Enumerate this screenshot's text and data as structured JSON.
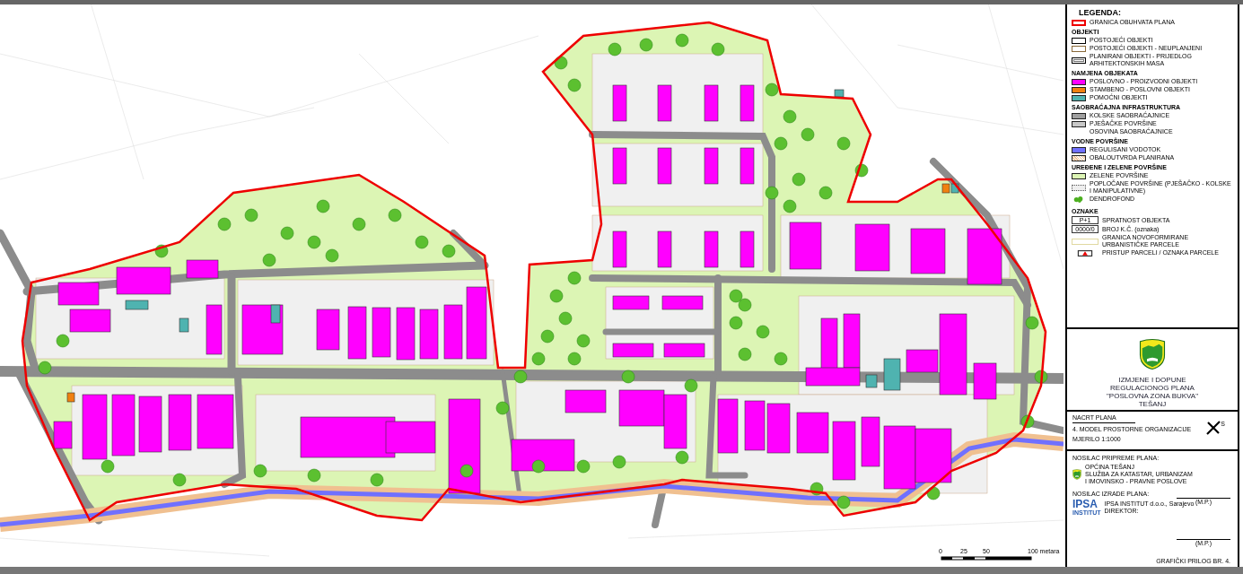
{
  "legend": {
    "title": "LEGENDA:",
    "boundary": {
      "label": "GRANICA OBUHVATA PLANA",
      "kind": "outline-red"
    },
    "sections": [
      {
        "heading": "OBJEKTI",
        "items": [
          {
            "label": "POSTOJEĆI OBJEKTI",
            "kind": "outline",
            "color": "#000000"
          },
          {
            "label": "POSTOJEĆI OBJEKTI - NEUPLANJENI",
            "kind": "outline",
            "color": "#8a6a3a"
          },
          {
            "label": "PLANIRANI OBJEKTI - PRIJEDLOG ARHITEKTONSKIH MASA",
            "kind": "double"
          }
        ]
      },
      {
        "heading": "NAMJENA OBJEKATA",
        "items": [
          {
            "label": "POSLOVNO - PROIZVODNI OBJEKTI",
            "kind": "fill",
            "color": "#ff00ff"
          },
          {
            "label": "STAMBENO - POSLOVNI OBJEKTI",
            "kind": "fill",
            "color": "#f08010"
          },
          {
            "label": "POMOĆNI OBJEKTI",
            "kind": "fill",
            "color": "#4fb3b0"
          }
        ]
      },
      {
        "heading": "SAOBRAĆAJNA INFRASTRUKTURA",
        "items": [
          {
            "label": "KOLSKE SAOBRAĆAJNICE",
            "kind": "fill",
            "color": "#a0a0a0"
          },
          {
            "label": "PJEŠAČKE POVRŠINE",
            "kind": "fill",
            "color": "#c8c8c8"
          },
          {
            "label": "OSOVINA SAOBRAĆAJNICE",
            "kind": "none"
          }
        ]
      },
      {
        "heading": "VODNE POVRŠINE",
        "items": [
          {
            "label": "REGULISANI VODOTOK",
            "kind": "fill",
            "color": "#7070ff"
          },
          {
            "label": "OBALOUTVRDA PLANIRANA",
            "kind": "hatch",
            "color": "#f0c090"
          }
        ]
      },
      {
        "heading": "UREĐENE I ZELENE POVRŠINE",
        "items": [
          {
            "label": "ZELENE POVRŠINE",
            "kind": "fill",
            "color": "#dcf5b4"
          },
          {
            "label": "POPLOČANE POVRŠINE (PJEŠAČKO - KOLSKE I MANIPULATIVNE)",
            "kind": "dotted"
          },
          {
            "label": "DENDROFOND",
            "kind": "tree"
          }
        ]
      }
    ]
  },
  "markers": {
    "heading": "OZNAKE",
    "items": [
      {
        "symbol": "P+1",
        "label": "SPRATNOST OBJEKTA",
        "kind": "box"
      },
      {
        "symbol": "0000/0",
        "label": "BROJ K.Č. (oznaka)",
        "kind": "box"
      },
      {
        "label": "GRANICA NOVOFORMIRANE URBANISTIČKE PARCELE",
        "kind": "plot"
      },
      {
        "label": "PRISTUP PARCELI / OZNAKA PARCELE",
        "kind": "access"
      }
    ]
  },
  "title_block": {
    "lines": [
      "IZMJENE I DOPUNE",
      "REGULACIONOG PLANA",
      "\"POSLOVNA ZONA BUKVA\"",
      "TEŠANJ"
    ]
  },
  "plan": {
    "heading": "NACRT PLANA",
    "name": "4. MODEL PROSTORNE ORGANIZACIJE",
    "scale": "MJERILO 1:1000",
    "north": "S"
  },
  "preparer": {
    "heading": "NOSILAC PRIPREME PLANA:",
    "lines": [
      "OPĆINA TEŠANJ",
      "SLUŽBA ZA KATASTAR, URBANIZAM",
      "I IMOVINSKO - PRAVNE POSLOVE"
    ],
    "stamp": "(M.P.)"
  },
  "author": {
    "heading": "NOSILAC IZRADE PLANA:",
    "logo": "IPSA",
    "logo_sub": "INSTITUT",
    "lines": [
      "IPSA INSTITUT d.o.o., Sarajevo",
      "DIREKTOR:"
    ],
    "stamp": "(M.P.)"
  },
  "annex": "GRAFIČKI PRILOG BR. 4.",
  "scale_bar": {
    "ticks": [
      "0",
      "25",
      "50",
      "100 metara"
    ]
  }
}
